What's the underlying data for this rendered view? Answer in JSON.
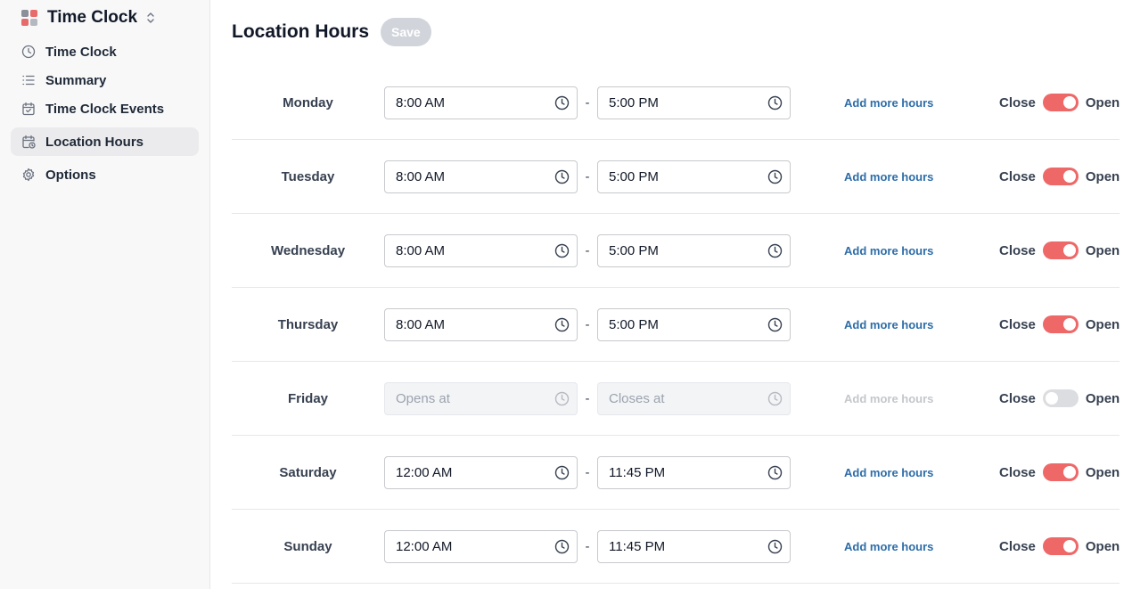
{
  "app": {
    "title": "Time Clock",
    "logo_colors": [
      "#8b8f99",
      "#e76b6b",
      "#e76b6b",
      "#b4b8c0"
    ]
  },
  "sidebar": {
    "items": [
      {
        "label": "Time Clock",
        "icon": "clock-icon",
        "active": false
      },
      {
        "label": "Summary",
        "icon": "list-icon",
        "active": false
      },
      {
        "label": "Time Clock Events",
        "icon": "calendar-check-icon",
        "active": false
      },
      {
        "label": "Location Hours",
        "icon": "calendar-clock-icon",
        "active": true
      },
      {
        "label": "Options",
        "icon": "gear-icon",
        "active": false
      }
    ]
  },
  "page": {
    "title": "Location Hours",
    "save_label": "Save"
  },
  "colors": {
    "accent": "#ee6868",
    "link": "#2d6da8"
  },
  "hours": [
    {
      "day": "Monday",
      "open": "8:00 AM",
      "close": "5:00 PM",
      "open_placeholder": "Opens at",
      "close_placeholder": "Closes at",
      "enabled": true,
      "more": "Add more hours",
      "close_label": "Close",
      "open_label": "Open"
    },
    {
      "day": "Tuesday",
      "open": "8:00 AM",
      "close": "5:00 PM",
      "open_placeholder": "Opens at",
      "close_placeholder": "Closes at",
      "enabled": true,
      "more": "Add more hours",
      "close_label": "Close",
      "open_label": "Open"
    },
    {
      "day": "Wednesday",
      "open": "8:00 AM",
      "close": "5:00 PM",
      "open_placeholder": "Opens at",
      "close_placeholder": "Closes at",
      "enabled": true,
      "more": "Add more hours",
      "close_label": "Close",
      "open_label": "Open"
    },
    {
      "day": "Thursday",
      "open": "8:00 AM",
      "close": "5:00 PM",
      "open_placeholder": "Opens at",
      "close_placeholder": "Closes at",
      "enabled": true,
      "more": "Add more hours",
      "close_label": "Close",
      "open_label": "Open"
    },
    {
      "day": "Friday",
      "open": "",
      "close": "",
      "open_placeholder": "Opens at",
      "close_placeholder": "Closes at",
      "enabled": false,
      "more": "Add more hours",
      "close_label": "Close",
      "open_label": "Open"
    },
    {
      "day": "Saturday",
      "open": "12:00 AM",
      "close": "11:45 PM",
      "open_placeholder": "Opens at",
      "close_placeholder": "Closes at",
      "enabled": true,
      "more": "Add more hours",
      "close_label": "Close",
      "open_label": "Open"
    },
    {
      "day": "Sunday",
      "open": "12:00 AM",
      "close": "11:45 PM",
      "open_placeholder": "Opens at",
      "close_placeholder": "Closes at",
      "enabled": true,
      "more": "Add more hours",
      "close_label": "Close",
      "open_label": "Open"
    }
  ]
}
